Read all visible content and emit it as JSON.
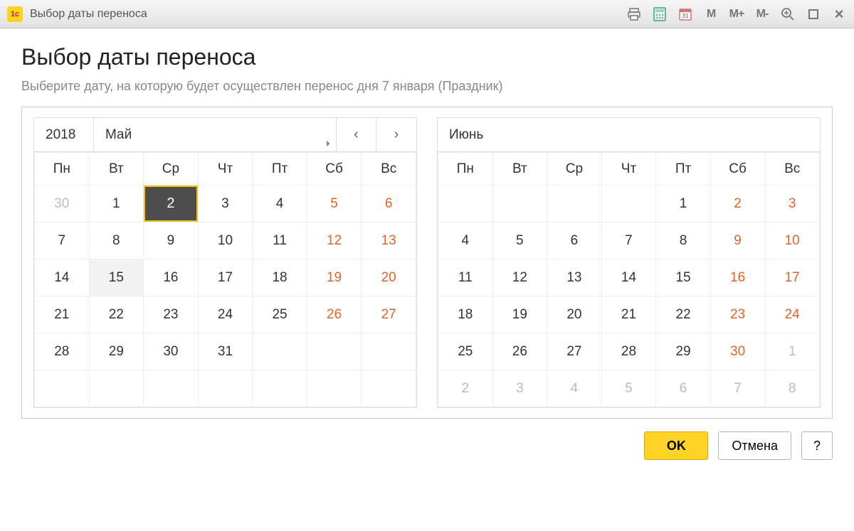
{
  "titlebar": {
    "title": "Выбор даты переноса",
    "mem_buttons": [
      "M",
      "M+",
      "M-"
    ]
  },
  "page": {
    "title": "Выбор даты переноса",
    "instruction": "Выберите дату, на которую будет осуществлен перенос дня 7 января (Праздник)"
  },
  "calendar": {
    "year": "2018",
    "weekdays": [
      "Пн",
      "Вт",
      "Ср",
      "Чт",
      "Пт",
      "Сб",
      "Вс"
    ],
    "month1": {
      "name": "Май",
      "weeks": [
        [
          {
            "d": "30",
            "other": true
          },
          {
            "d": "1"
          },
          {
            "d": "2",
            "selected": true
          },
          {
            "d": "3"
          },
          {
            "d": "4"
          },
          {
            "d": "5",
            "w": true
          },
          {
            "d": "6",
            "w": true
          }
        ],
        [
          {
            "d": "7"
          },
          {
            "d": "8"
          },
          {
            "d": "9"
          },
          {
            "d": "10"
          },
          {
            "d": "11"
          },
          {
            "d": "12",
            "w": true
          },
          {
            "d": "13",
            "w": true
          }
        ],
        [
          {
            "d": "14"
          },
          {
            "d": "15",
            "hover": true
          },
          {
            "d": "16"
          },
          {
            "d": "17"
          },
          {
            "d": "18"
          },
          {
            "d": "19",
            "w": true
          },
          {
            "d": "20",
            "w": true
          }
        ],
        [
          {
            "d": "21"
          },
          {
            "d": "22"
          },
          {
            "d": "23"
          },
          {
            "d": "24"
          },
          {
            "d": "25"
          },
          {
            "d": "26",
            "w": true
          },
          {
            "d": "27",
            "w": true
          }
        ],
        [
          {
            "d": "28"
          },
          {
            "d": "29"
          },
          {
            "d": "30"
          },
          {
            "d": "31"
          },
          {
            "d": ""
          },
          {
            "d": ""
          },
          {
            "d": ""
          }
        ],
        [
          {
            "d": ""
          },
          {
            "d": ""
          },
          {
            "d": ""
          },
          {
            "d": ""
          },
          {
            "d": ""
          },
          {
            "d": ""
          },
          {
            "d": ""
          }
        ]
      ]
    },
    "month2": {
      "name": "Июнь",
      "weeks": [
        [
          {
            "d": ""
          },
          {
            "d": ""
          },
          {
            "d": ""
          },
          {
            "d": ""
          },
          {
            "d": "1"
          },
          {
            "d": "2",
            "w": true
          },
          {
            "d": "3",
            "w": true
          }
        ],
        [
          {
            "d": "4"
          },
          {
            "d": "5"
          },
          {
            "d": "6"
          },
          {
            "d": "7"
          },
          {
            "d": "8"
          },
          {
            "d": "9",
            "w": true
          },
          {
            "d": "10",
            "w": true
          }
        ],
        [
          {
            "d": "11"
          },
          {
            "d": "12"
          },
          {
            "d": "13"
          },
          {
            "d": "14"
          },
          {
            "d": "15"
          },
          {
            "d": "16",
            "w": true
          },
          {
            "d": "17",
            "w": true
          }
        ],
        [
          {
            "d": "18"
          },
          {
            "d": "19"
          },
          {
            "d": "20"
          },
          {
            "d": "21"
          },
          {
            "d": "22"
          },
          {
            "d": "23",
            "w": true
          },
          {
            "d": "24",
            "w": true
          }
        ],
        [
          {
            "d": "25"
          },
          {
            "d": "26"
          },
          {
            "d": "27"
          },
          {
            "d": "28"
          },
          {
            "d": "29"
          },
          {
            "d": "30",
            "w": true
          },
          {
            "d": "1",
            "other": true
          }
        ],
        [
          {
            "d": "2",
            "other": true
          },
          {
            "d": "3",
            "other": true
          },
          {
            "d": "4",
            "other": true
          },
          {
            "d": "5",
            "other": true
          },
          {
            "d": "6",
            "other": true
          },
          {
            "d": "7",
            "other": true
          },
          {
            "d": "8",
            "other": true
          }
        ]
      ]
    }
  },
  "buttons": {
    "ok": "OK",
    "cancel": "Отмена",
    "help": "?"
  }
}
